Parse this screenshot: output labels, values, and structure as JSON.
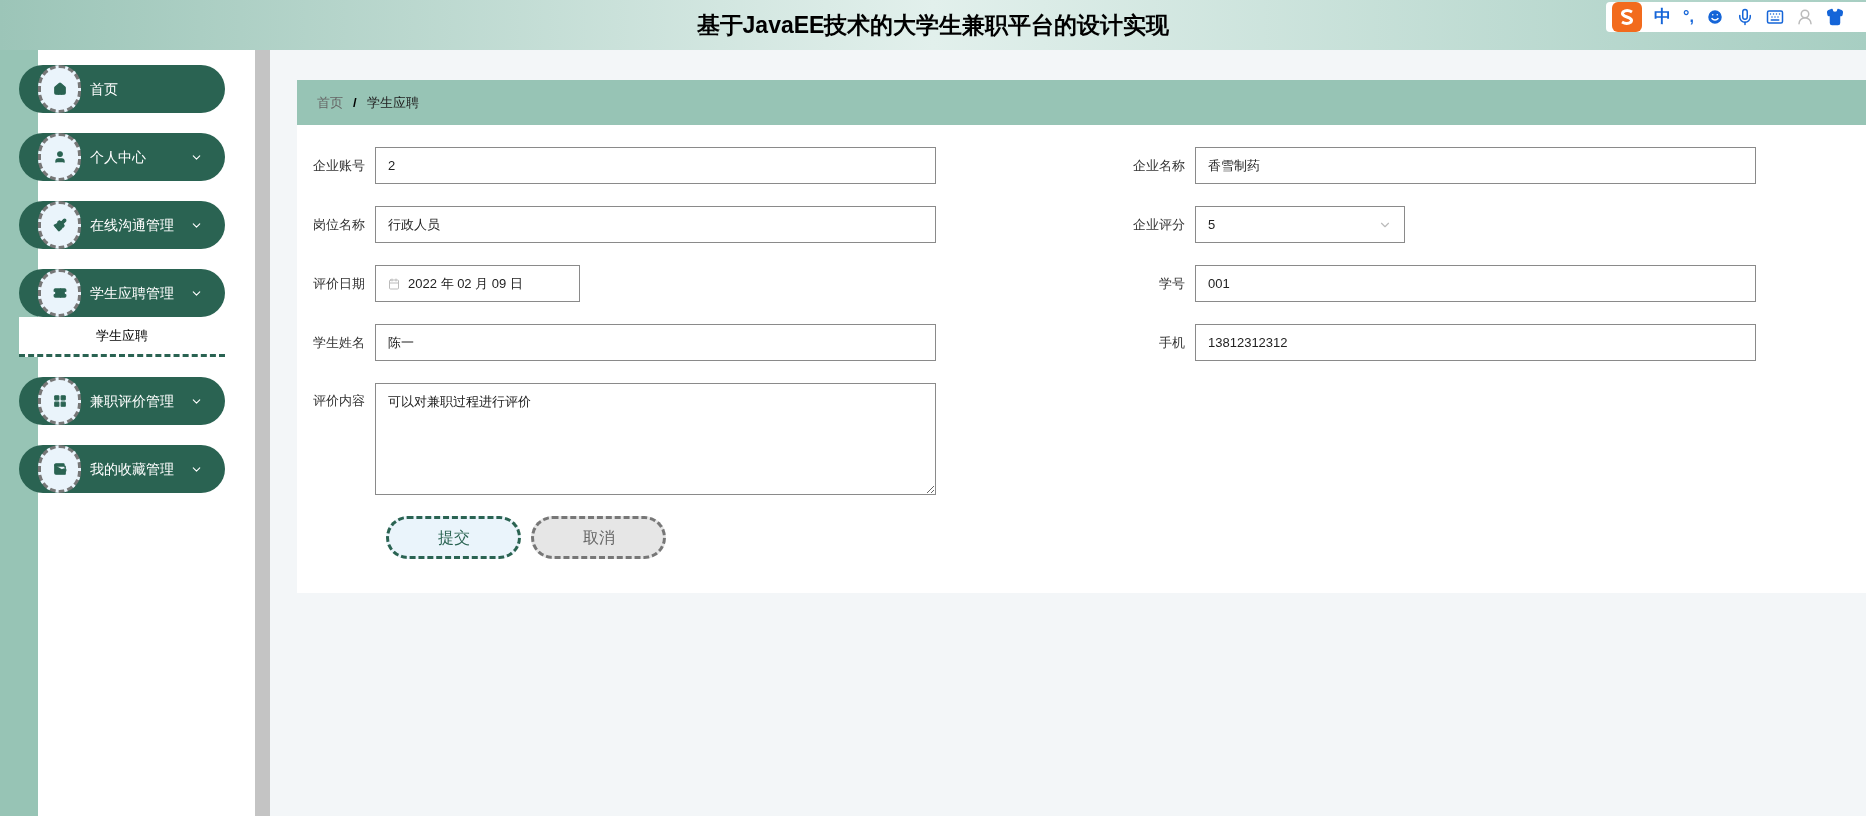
{
  "header": {
    "title": "基于JavaEE技术的大学生兼职平台的设计实现"
  },
  "ime_bar": {
    "mode": "中",
    "punctuation": "°,"
  },
  "sidebar": {
    "items": [
      {
        "label": "首页",
        "kind": "link"
      },
      {
        "label": "个人中心",
        "kind": "menu"
      },
      {
        "label": "在线沟通管理",
        "kind": "menu"
      },
      {
        "label": "学生应聘管理",
        "kind": "menu",
        "children": [
          {
            "label": "学生应聘"
          }
        ]
      },
      {
        "label": "兼职评价管理",
        "kind": "menu"
      },
      {
        "label": "我的收藏管理",
        "kind": "menu"
      }
    ]
  },
  "breadcrumb": {
    "items": [
      "首页",
      "学生应聘"
    ],
    "separator": "/"
  },
  "form": {
    "fields": [
      {
        "label": "企业账号",
        "kind": "text",
        "value": "2"
      },
      {
        "label": "企业名称",
        "kind": "text",
        "value": "香雪制药"
      },
      {
        "label": "岗位名称",
        "kind": "text",
        "value": "行政人员"
      },
      {
        "label": "企业评分",
        "kind": "select",
        "value": "5"
      },
      {
        "label": "评价日期",
        "kind": "date",
        "value": "2022 年 02 月 09 日"
      },
      {
        "label": "学号",
        "kind": "text",
        "value": "001"
      },
      {
        "label": "学生姓名",
        "kind": "text",
        "value": "陈一"
      },
      {
        "label": "手机",
        "kind": "text",
        "value": "13812312312"
      },
      {
        "label": "评价内容",
        "kind": "textarea",
        "value": "可以对兼职过程进行评价"
      }
    ],
    "buttons": [
      {
        "label": "提交",
        "kind": "primary"
      },
      {
        "label": "取消",
        "kind": "secondary"
      }
    ]
  }
}
